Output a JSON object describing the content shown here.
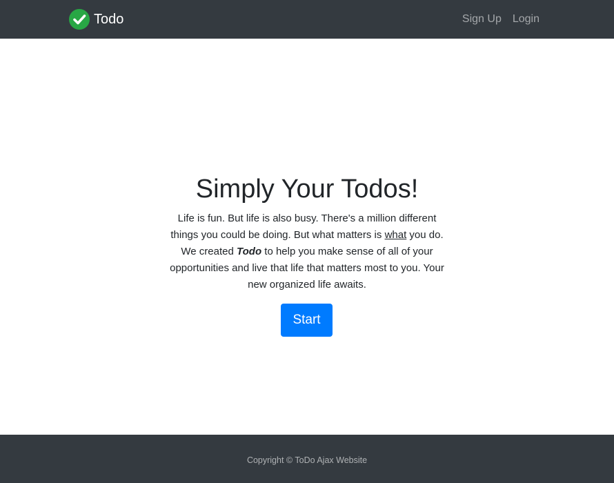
{
  "navbar": {
    "brand": "Todo",
    "brand_icon": "check-circle-icon",
    "links": [
      {
        "label": "Sign Up"
      },
      {
        "label": "Login"
      }
    ]
  },
  "hero": {
    "title": "Simply Your Todos!",
    "text_part1": "Life is fun. But life is also busy. There's a million different things you could be doing. But what matters is ",
    "text_underlined": "what",
    "text_part2": " you do. We created ",
    "text_brand": "Todo",
    "text_part3": " to help you make sense of all of your opportunities and live that life that matters most to you. Your new organized life awaits.",
    "start_label": "Start"
  },
  "footer": {
    "copyright": "Copyright © ToDo Ajax Website"
  },
  "colors": {
    "navbar_bg": "#343a40",
    "primary": "#007bff",
    "brand_icon": "#28a745"
  }
}
